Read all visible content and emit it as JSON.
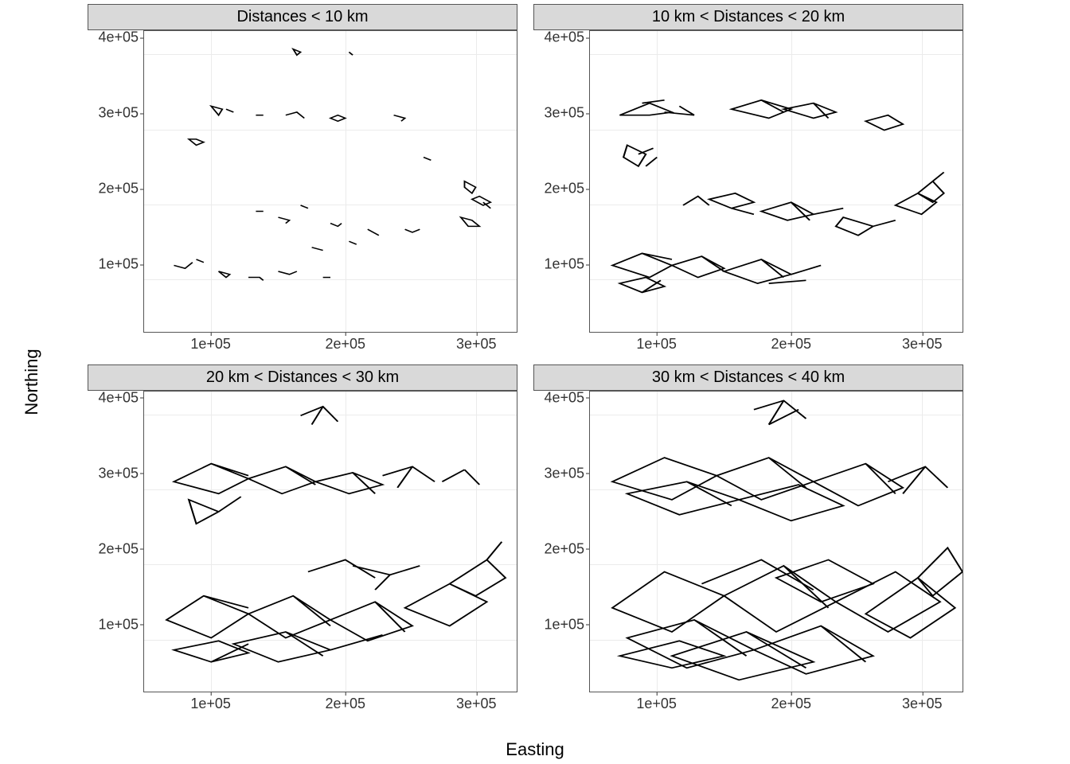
{
  "chart_data": [
    {
      "type": "network",
      "title": "Distances < 10 km",
      "xlabel": "Easting",
      "ylabel": "Northing",
      "xlim": [
        50000,
        330000
      ],
      "ylim": [
        30000,
        430000
      ],
      "x_ticks": [
        100000,
        200000,
        300000
      ],
      "y_ticks": [
        100000,
        200000,
        300000,
        400000
      ],
      "x_tick_labels": [
        "1e+05",
        "2e+05",
        "3e+05"
      ],
      "y_tick_labels": [
        "1e+05",
        "2e+05",
        "3e+05",
        "4e+05"
      ],
      "distance_band_km": [
        0,
        10
      ],
      "description": "Sparse short-range connections between spatial point locations; small isolated clusters scattered across region."
    },
    {
      "type": "network",
      "title": "10 km < Distances < 20 km",
      "xlabel": "Easting",
      "ylabel": "Northing",
      "xlim": [
        50000,
        330000
      ],
      "ylim": [
        30000,
        430000
      ],
      "x_ticks": [
        100000,
        200000,
        300000
      ],
      "y_ticks": [
        100000,
        200000,
        300000,
        400000
      ],
      "x_tick_labels": [
        "1e+05",
        "2e+05",
        "3e+05"
      ],
      "y_tick_labels": [
        "1e+05",
        "2e+05",
        "3e+05",
        "4e+05"
      ],
      "distance_band_km": [
        10,
        20
      ],
      "description": "Moderately dense connections forming distinct clusters in south and a horizontal band near y≈3.2e5."
    },
    {
      "type": "network",
      "title": "20 km < Distances < 30 km",
      "xlabel": "Easting",
      "ylabel": "Northing",
      "xlim": [
        50000,
        330000
      ],
      "ylim": [
        30000,
        430000
      ],
      "x_ticks": [
        100000,
        200000,
        300000
      ],
      "y_ticks": [
        100000,
        200000,
        300000,
        400000
      ],
      "x_tick_labels": [
        "1e+05",
        "2e+05",
        "3e+05"
      ],
      "y_tick_labels": [
        "1e+05",
        "2e+05",
        "3e+05",
        "4e+05"
      ],
      "distance_band_km": [
        20,
        30
      ],
      "description": "Dense network; large connected southern component and linked northern band."
    },
    {
      "type": "network",
      "title": "30 km < Distances < 40 km",
      "xlabel": "Easting",
      "ylabel": "Northing",
      "xlim": [
        50000,
        330000
      ],
      "ylim": [
        30000,
        430000
      ],
      "x_ticks": [
        100000,
        200000,
        300000
      ],
      "y_ticks": [
        100000,
        200000,
        300000,
        400000
      ],
      "x_tick_labels": [
        "1e+05",
        "2e+05",
        "3e+05"
      ],
      "y_tick_labels": [
        "1e+05",
        "2e+05",
        "3e+05",
        "4e+05"
      ],
      "distance_band_km": [
        30,
        40
      ],
      "description": "Very dense network; heavily interconnected southern mass and strongly cross-linked northern band."
    }
  ],
  "axis_labels": {
    "x": "Easting",
    "y": "Northing"
  }
}
